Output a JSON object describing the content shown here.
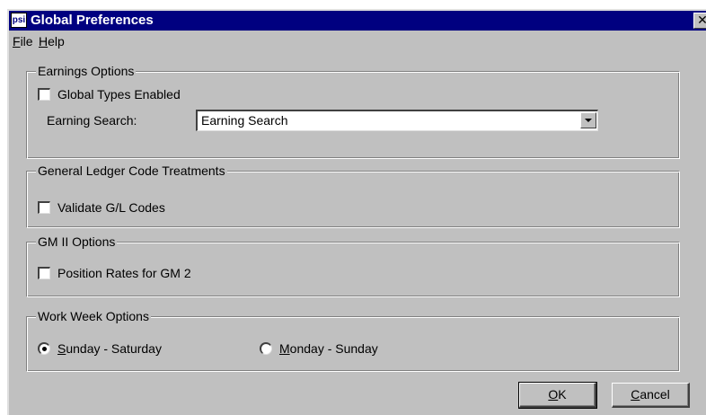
{
  "window": {
    "title": "Global Preferences",
    "app_icon_text": "psi",
    "close_glyph": "✕"
  },
  "menu": [
    {
      "mnemonic": "F",
      "rest": "ile"
    },
    {
      "mnemonic": "H",
      "rest": "elp"
    }
  ],
  "earnings": {
    "group_title": "Earnings Options",
    "global_types_label": "Global Types Enabled",
    "global_types_checked": false,
    "search_label": "Earning Search:",
    "search_value": "Earning Search"
  },
  "gl": {
    "group_title": "General Ledger Code Treatments",
    "validate_label": "Validate G/L Codes",
    "validate_checked": false
  },
  "gm": {
    "group_title": "GM II Options",
    "position_rates_label": "Position Rates for GM 2",
    "position_rates_checked": false
  },
  "workweek": {
    "group_title": "Work Week Options",
    "options": [
      {
        "mnemonic": "S",
        "rest": "unday - Saturday",
        "selected": true
      },
      {
        "mnemonic": "M",
        "rest": "onday - Sunday",
        "selected": false
      }
    ]
  },
  "buttons": {
    "ok": {
      "mnemonic": "O",
      "rest": "K"
    },
    "cancel": {
      "mnemonic": "C",
      "rest": "ancel"
    }
  },
  "colors": {
    "titlebar": "#000080",
    "face": "#c0c0c0"
  }
}
